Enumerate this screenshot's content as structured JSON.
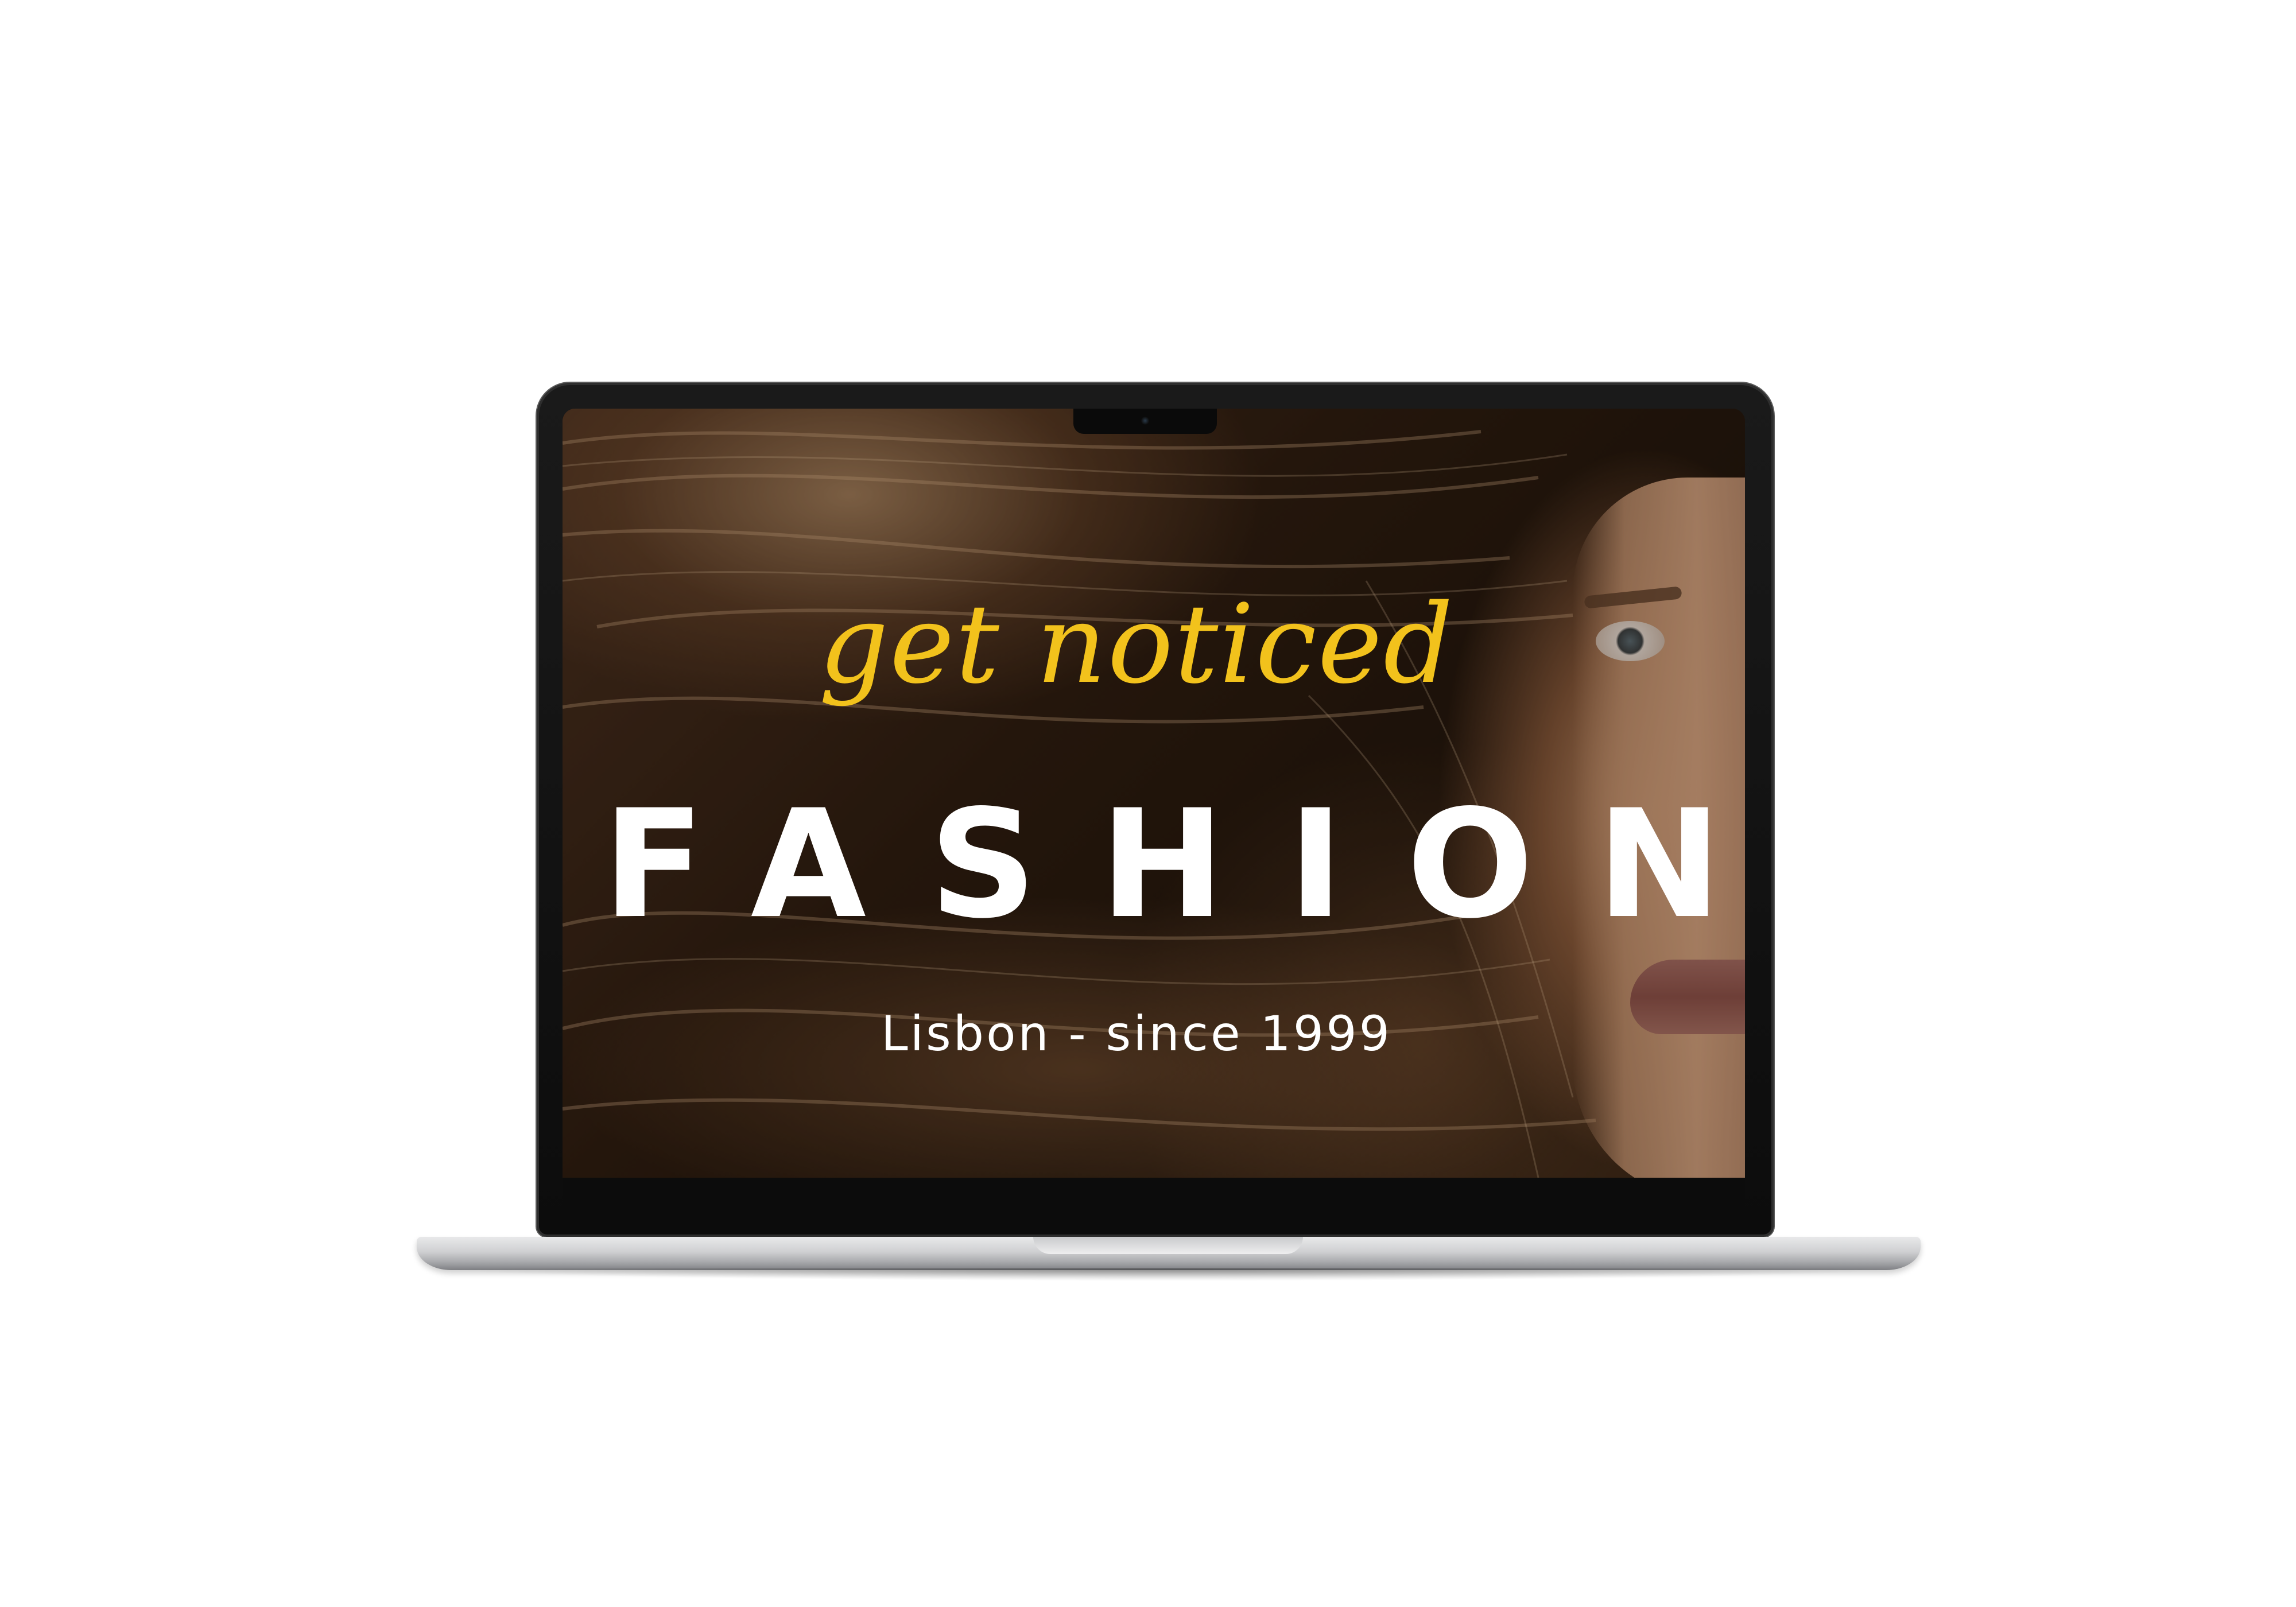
{
  "hero": {
    "tagline": "get noticed",
    "headline": "FASHION",
    "subline": "Lisbon - since 1999"
  },
  "colors": {
    "tagline": "#f2c21c",
    "headline": "#ffffff",
    "subline": "#ffffff",
    "background": "#ffffff",
    "laptop_bezel": "#0c0c0c",
    "laptop_base": "#cfd0d2"
  },
  "icons": {
    "camera": "camera-icon"
  }
}
